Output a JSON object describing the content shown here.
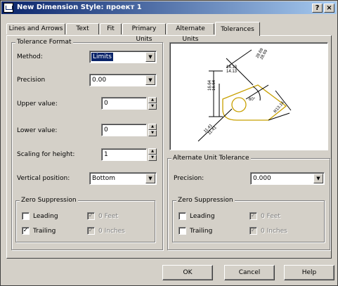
{
  "window": {
    "title": "New Dimension Style: проект 1",
    "help_btn": "?",
    "close_btn": "×"
  },
  "tabs": [
    {
      "label": "Lines and Arrows"
    },
    {
      "label": "Text"
    },
    {
      "label": "Fit"
    },
    {
      "label": "Primary Units"
    },
    {
      "label": "Alternate Units"
    },
    {
      "label": "Tolerances"
    }
  ],
  "tolerance_format": {
    "title": "Tolerance Format",
    "method_label": "Method:",
    "method_value": "Limits",
    "precision_label": "Precision",
    "precision_value": "0.00",
    "upper_label": "Upper value:",
    "upper_value": "0",
    "lower_label": "Lower value:",
    "lower_value": "0",
    "scaling_label": "Scaling for height:",
    "scaling_value": "1",
    "vertical_label": "Vertical position:",
    "vertical_value": "Bottom",
    "zero": {
      "title": "Zero Suppression",
      "leading": "Leading",
      "trailing": "Trailing",
      "feet": "0 Feet",
      "inches": "0 Inches",
      "leading_checked": false,
      "trailing_checked": true
    }
  },
  "alt_unit_tolerance": {
    "title": "Alternate Unit Tolerance",
    "precision_label": "Precision:",
    "precision_value": "0.000",
    "zero": {
      "title": "Zero Suppression",
      "leading": "Leading",
      "trailing": "Trailing",
      "feet": "0 Feet",
      "inches": "0 Inches"
    }
  },
  "preview": {
    "dims": [
      "16.64",
      "16.64",
      "14.13",
      "14.13",
      "28.69",
      "28.69",
      "60°",
      "11.41",
      "11.41",
      "R13.14"
    ]
  },
  "buttons": {
    "ok": "OK",
    "cancel": "Cancel",
    "help": "Help"
  }
}
